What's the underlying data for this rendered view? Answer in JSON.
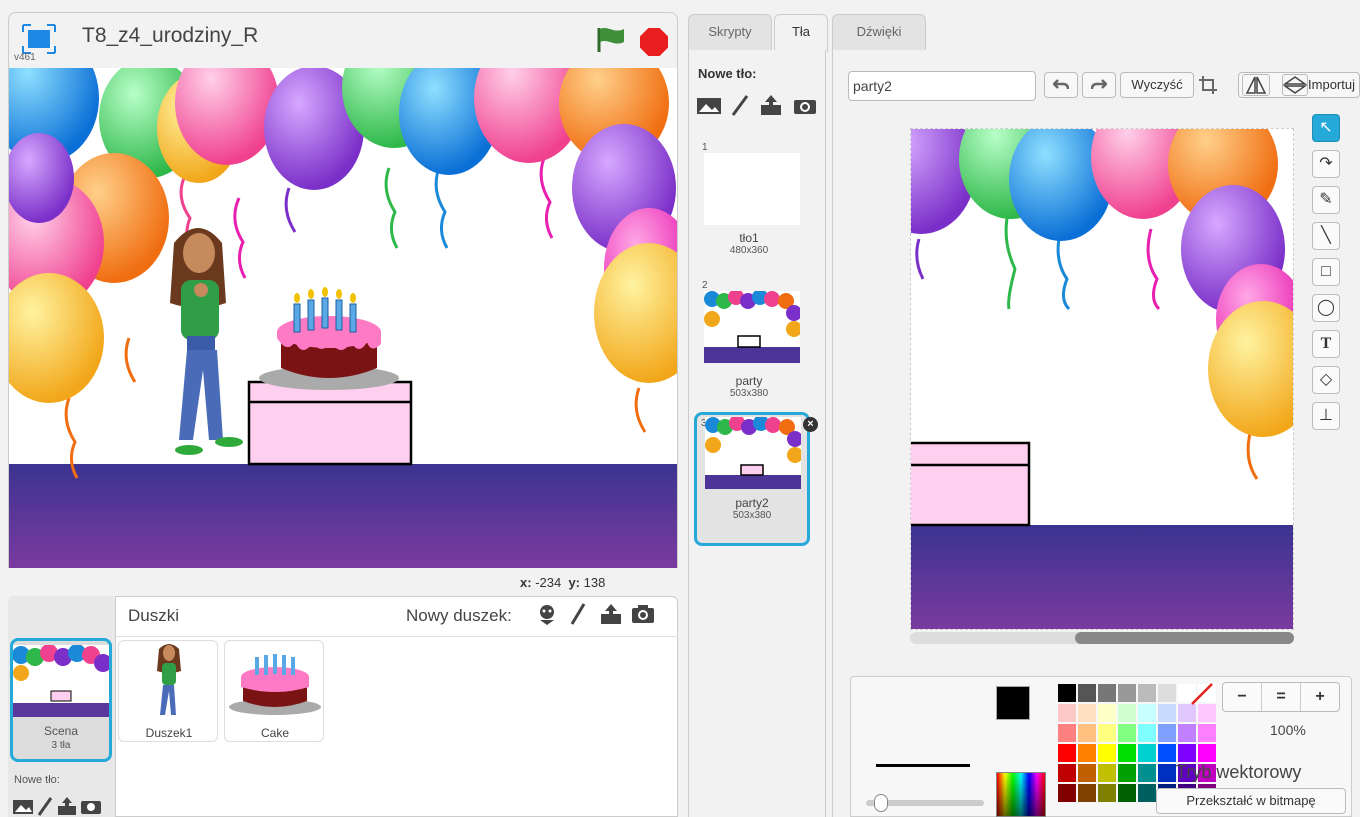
{
  "stage": {
    "version": "v461",
    "project_title": "T8_z4_urodziny_R",
    "mouse_x_label": "x:",
    "mouse_x": "-234",
    "mouse_y_label": "y:",
    "mouse_y": "138"
  },
  "sprites": {
    "title": "Duszki",
    "new_sprite_label": "Nowy duszek:",
    "scene": {
      "label": "Scena",
      "count": "3 tła",
      "new_backdrop_label": "Nowe tło:"
    },
    "items": [
      {
        "name": "Duszek1"
      },
      {
        "name": "Cake"
      }
    ]
  },
  "tabs": [
    {
      "label": "Skrypty"
    },
    {
      "label": "Tła"
    },
    {
      "label": "Dźwięki"
    }
  ],
  "backdrops": {
    "new_label": "Nowe tło:",
    "items": [
      {
        "num": "1",
        "name": "tło1",
        "size": "480x360"
      },
      {
        "num": "2",
        "name": "party",
        "size": "503x380"
      },
      {
        "num": "3",
        "name": "party2",
        "size": "503x380"
      }
    ]
  },
  "editor": {
    "costume_name": "party2",
    "clear_label": "Wyczyść",
    "import_label": "Importuj",
    "zoom": "100%",
    "mode_label": "Tryb wektorowy",
    "convert_label": "Przekształć w bitmapę",
    "zoom_buttons": [
      "−",
      "=",
      "+"
    ]
  },
  "colors": {
    "accent": "#25a9d9",
    "floor_top": "#3b3490",
    "floor_bottom": "#7b3aa0",
    "table": "#ffcff0",
    "stop": "#e91e1e",
    "flag": "#3f8f3a"
  },
  "palette": [
    "#000000",
    "#555555",
    "#777777",
    "#999999",
    "#bbbbbb",
    "#dddddd",
    "#ffffff",
    "#ffffff",
    "#ffc8c8",
    "#ffe0c0",
    "#ffffc8",
    "#d0ffd0",
    "#c8ffff",
    "#c8dcff",
    "#e0c8ff",
    "#ffc8ff",
    "#ff8080",
    "#ffc080",
    "#ffff80",
    "#80ff80",
    "#80ffff",
    "#80a0ff",
    "#c080ff",
    "#ff80ff",
    "#ff0000",
    "#ff8000",
    "#ffff00",
    "#00e000",
    "#00d0d0",
    "#0050ff",
    "#8000ff",
    "#ff00ff",
    "#c00000",
    "#c06000",
    "#c0c000",
    "#00a000",
    "#009090",
    "#0030c0",
    "#6000c0",
    "#c000c0",
    "#800000",
    "#804000",
    "#808000",
    "#006000",
    "#006060",
    "#002080",
    "#400080",
    "#800080"
  ]
}
